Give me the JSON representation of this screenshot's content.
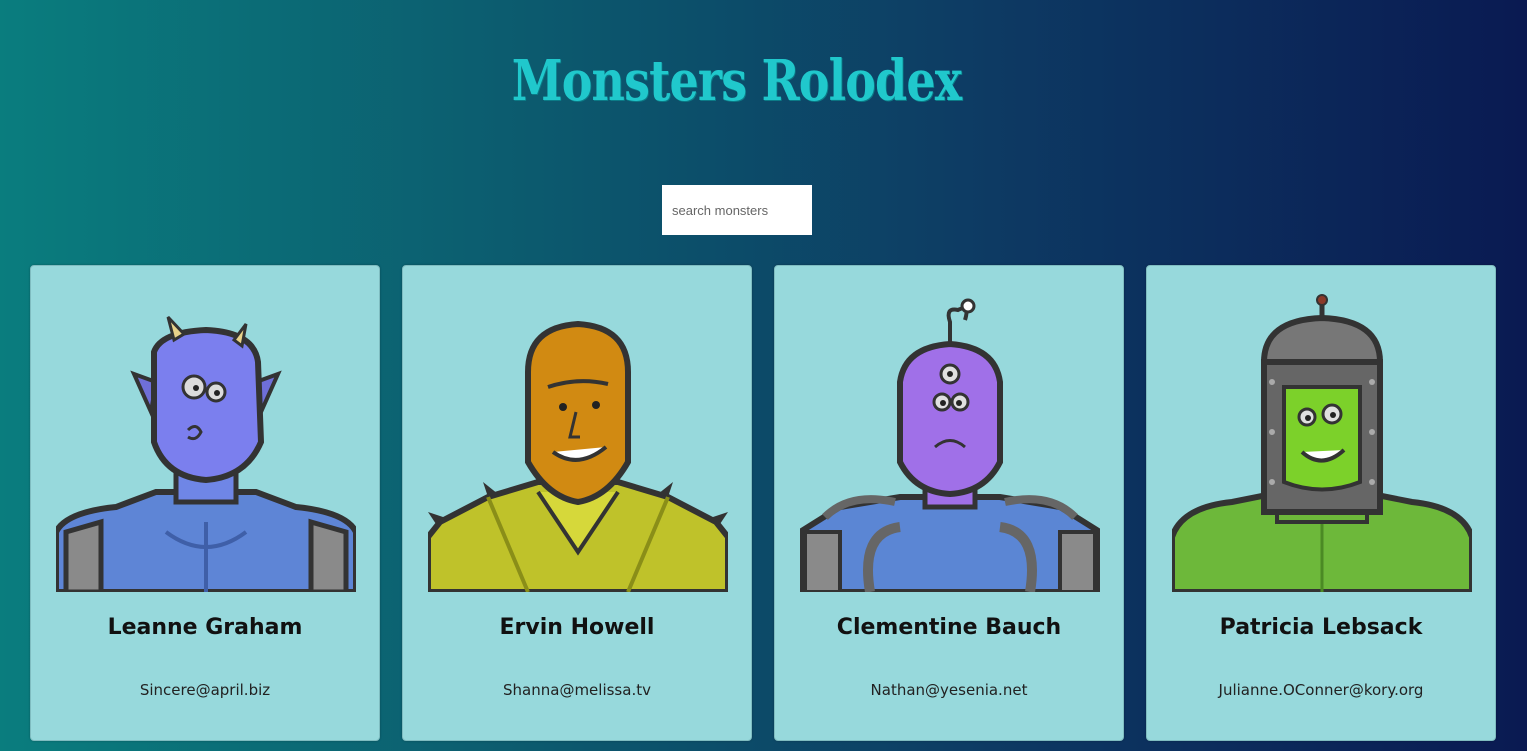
{
  "header": {
    "title": "Monsters Rolodex"
  },
  "search": {
    "placeholder": "search monsters",
    "value": ""
  },
  "monsters": [
    {
      "name": "Leanne Graham",
      "email": "Sincere@april.biz",
      "icon": "blue-horned-monster-icon"
    },
    {
      "name": "Ervin Howell",
      "email": "Shanna@melissa.tv",
      "icon": "orange-spiky-monster-icon"
    },
    {
      "name": "Clementine Bauch",
      "email": "Nathan@yesenia.net",
      "icon": "purple-cyclops-monster-icon"
    },
    {
      "name": "Patricia Lebsack",
      "email": "Julianne.OConner@kory.org",
      "icon": "green-robot-monster-icon"
    }
  ],
  "colors": {
    "title": "#20c8cc",
    "card_background": "#97d9dc",
    "gradient_start": "#0a7d7e",
    "gradient_end": "#0a1a52"
  }
}
